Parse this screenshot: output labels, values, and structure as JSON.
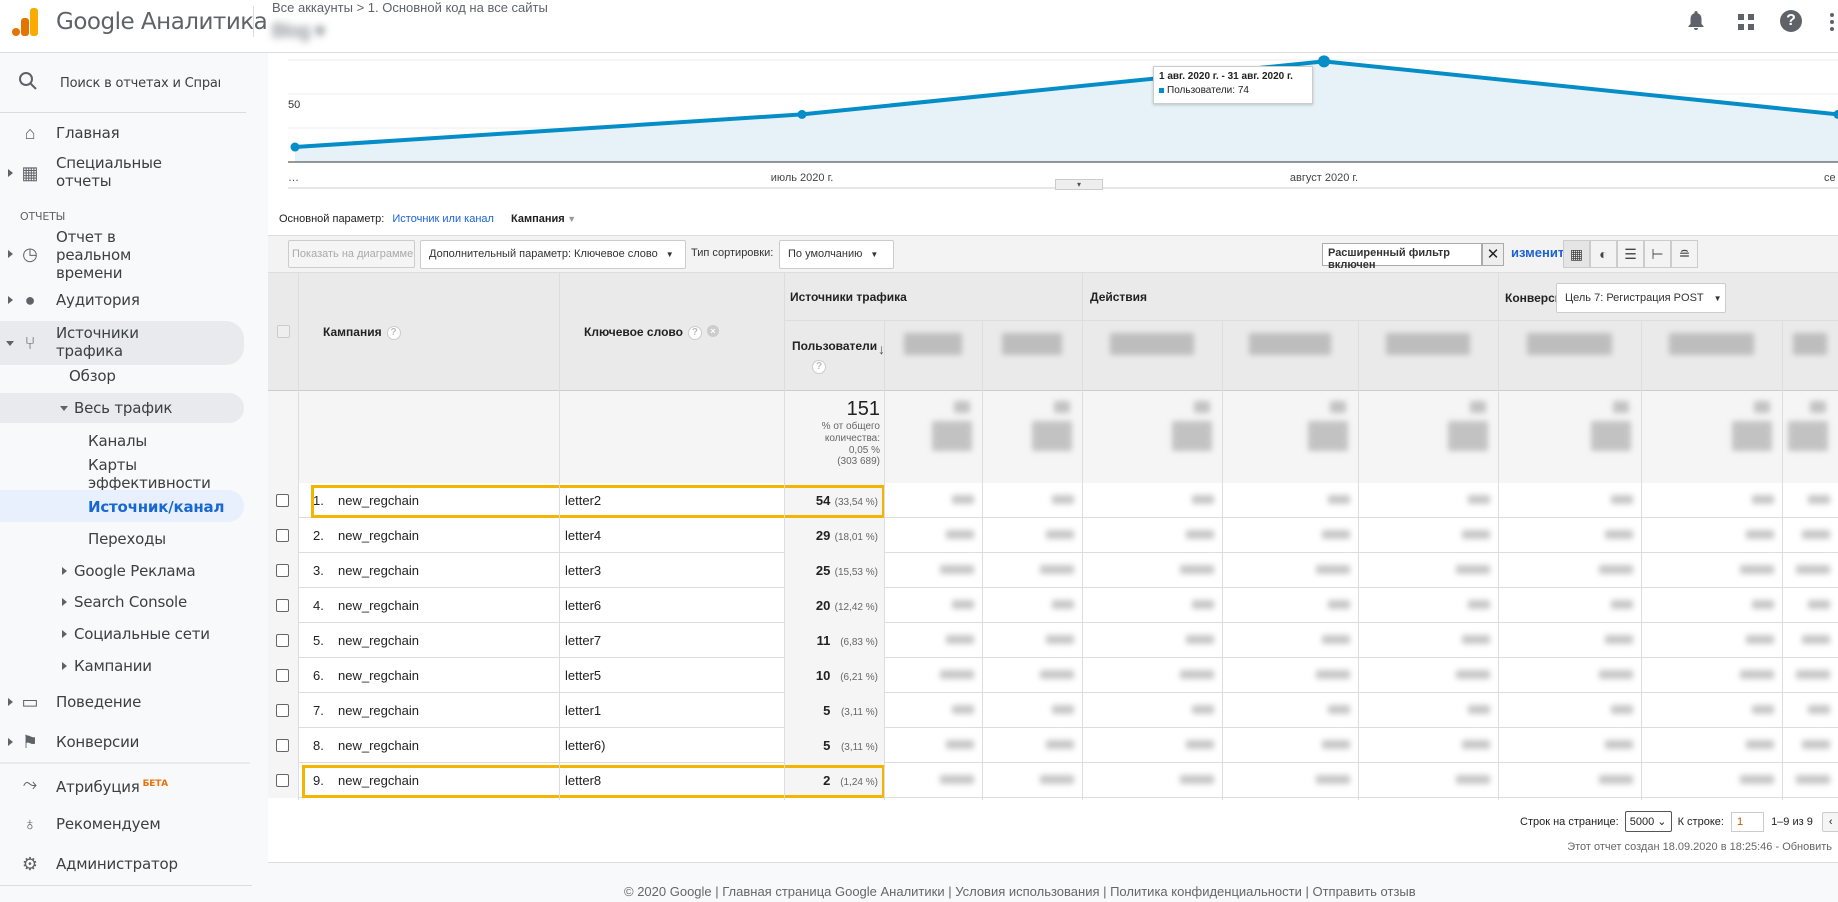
{
  "header": {
    "app_name": "Google Аналитика",
    "breadcrumb": "Все аккаунты > 1. Основной код на все сайты",
    "property": "Blog",
    "icons": [
      "bell-icon",
      "apps-icon",
      "help-icon",
      "more-icon"
    ]
  },
  "sidebar": {
    "search_placeholder": "Поиск в отчетах и Справке",
    "section_label": "ОТЧЕТЫ",
    "home": "Главная",
    "custom_reports": [
      "Специальные",
      "отчеты"
    ],
    "realtime": [
      "Отчет в",
      "реальном",
      "времени"
    ],
    "audience": "Аудитория",
    "acquisition": [
      "Источники",
      "трафика"
    ],
    "overview": "Обзор",
    "all_traffic": "Весь трафик",
    "channels": "Каналы",
    "treemaps": [
      "Карты",
      "эффективности"
    ],
    "source_medium": "Источник/канал",
    "referrals": "Переходы",
    "google_ads": "Google Реклама",
    "search_console": "Search Console",
    "social": "Социальные сети",
    "campaigns": "Кампании",
    "behavior": "Поведение",
    "conversions": "Конверсии",
    "attribution": "Атрибуция",
    "beta": "БЕТА",
    "discover": "Рекомендуем",
    "admin": "Администратор"
  },
  "chart_data": {
    "type": "area",
    "x": [
      "…",
      "июль 2020 г.",
      "август 2020 г.",
      "се"
    ],
    "series": [
      {
        "name": "Пользователи",
        "values": [
          11,
          35,
          74,
          35
        ]
      }
    ],
    "y_tick_labels": [
      "50"
    ],
    "ylim": [
      0,
      100
    ],
    "color": "#058dc7",
    "tooltip": {
      "title": "1 авг. 2020 г. - 31 авг. 2020 г.",
      "label": "Пользователи: 74"
    }
  },
  "dimension": {
    "label": "Основной параметр:",
    "link": "Источник или канал",
    "active": "Кампания"
  },
  "toolbar": {
    "plot_rows": "Показать на диаграмме",
    "secondary": "Дополнительный параметр: Ключевое слово",
    "sort_label": "Тип сортировки:",
    "sort_value": "По умолчанию",
    "filter_value": "Расширенный фильтр включен",
    "edit": "изменить"
  },
  "table": {
    "col_campaign": "Кампания",
    "col_keyword": "Ключевое слово",
    "group_acquisition": "Источники трафика",
    "group_behavior": "Действия",
    "group_conversions": "Конверсии",
    "goal_select": "Цель 7: Регистрация POST",
    "col_users": "Пользователи",
    "total": {
      "value": "151",
      "pct_label": "% от общего количества:",
      "pct": "0,05 %",
      "all": "(303 689)"
    },
    "rows": [
      {
        "n": "1.",
        "campaign": "new_regchain",
        "keyword": "letter2",
        "users": "54",
        "pct": "(33,54 %)",
        "highlight": true
      },
      {
        "n": "2.",
        "campaign": "new_regchain",
        "keyword": "letter4",
        "users": "29",
        "pct": "(18,01 %)"
      },
      {
        "n": "3.",
        "campaign": "new_regchain",
        "keyword": "letter3",
        "users": "25",
        "pct": "(15,53 %)"
      },
      {
        "n": "4.",
        "campaign": "new_regchain",
        "keyword": "letter6",
        "users": "20",
        "pct": "(12,42 %)"
      },
      {
        "n": "5.",
        "campaign": "new_regchain",
        "keyword": "letter7",
        "users": "11",
        "pct": "(6,83 %)"
      },
      {
        "n": "6.",
        "campaign": "new_regchain",
        "keyword": "letter5",
        "users": "10",
        "pct": "(6,21 %)"
      },
      {
        "n": "7.",
        "campaign": "new_regchain",
        "keyword": "letter1",
        "users": "5",
        "pct": "(3,11 %)"
      },
      {
        "n": "8.",
        "campaign": "new_regchain",
        "keyword": "letter6)",
        "users": "5",
        "pct": "(3,11 %)"
      },
      {
        "n": "9.",
        "campaign": "new_regchain",
        "keyword": "letter8",
        "users": "2",
        "pct": "(1,24 %)",
        "highlight": true
      }
    ],
    "highlight_color": "#f4b400"
  },
  "pagination": {
    "rows_label": "Строк на странице:",
    "rows_value": "5000",
    "goto_label": "К строке:",
    "goto_value": "1",
    "range": "1–9 из 9"
  },
  "report_created": "Этот отчет создан 18.09.2020 в 18:25:46 - Обновить",
  "footer": "© 2020 Google | Главная страница Google Аналитики | Условия использования | Политика конфиденциальности | Отправить отзыв"
}
